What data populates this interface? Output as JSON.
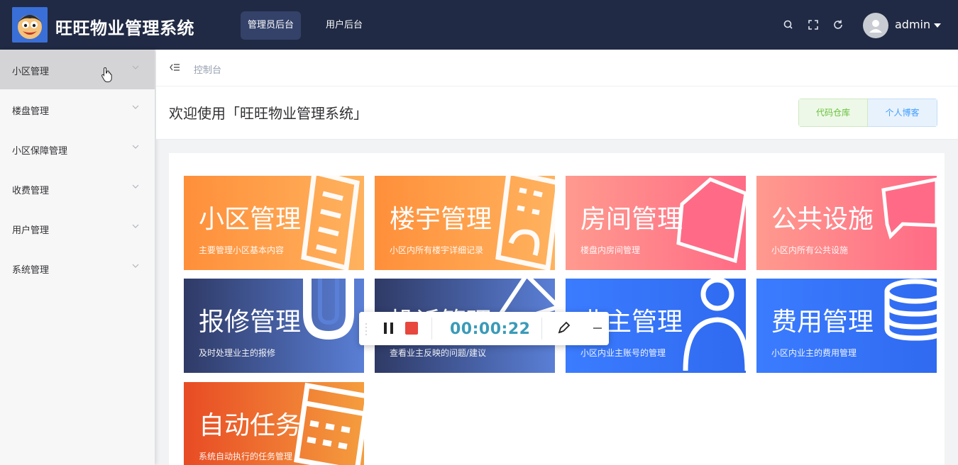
{
  "header": {
    "app_title": "旺旺物业管理系统",
    "tabs": [
      {
        "label": "管理员后台",
        "active": true
      },
      {
        "label": "用户后台",
        "active": false
      }
    ],
    "icons": [
      "search-icon",
      "fullscreen-icon",
      "refresh-icon"
    ],
    "user": {
      "name": "admin"
    },
    "background": "#202a44"
  },
  "sidebar": {
    "items": [
      {
        "label": "小区管理",
        "active": true
      },
      {
        "label": "楼盘管理",
        "active": false
      },
      {
        "label": "小区保障管理",
        "active": false
      },
      {
        "label": "收费管理",
        "active": false
      },
      {
        "label": "用户管理",
        "active": false
      },
      {
        "label": "系统管理",
        "active": false
      }
    ]
  },
  "breadcrumb": {
    "current": "控制台"
  },
  "welcome": {
    "title": "欢迎使用「旺旺物业管理系统」",
    "buttons": {
      "repo": "代码仓库",
      "blog": "个人博客"
    }
  },
  "cards": [
    {
      "title": "小区管理",
      "subtitle": "主要管理小区基本内容",
      "icon": "building-icon",
      "colors": [
        "#ff8f3a",
        "#ffb25e"
      ]
    },
    {
      "title": "楼宇管理",
      "subtitle": "小区内所有楼宇详细记录",
      "icon": "tower-icon",
      "colors": [
        "#ff8f3a",
        "#ffb25e"
      ]
    },
    {
      "title": "房间管理",
      "subtitle": "楼盘内房间管理",
      "icon": "house-icon",
      "colors": [
        "#ff9a8e",
        "#ff6b86"
      ]
    },
    {
      "title": "公共设施",
      "subtitle": "小区内所有公共设施",
      "icon": "flag-icon",
      "colors": [
        "#ff9a8e",
        "#ff6b86"
      ]
    },
    {
      "title": "报修管理",
      "subtitle": "及时处理业主的报修",
      "icon": "magnet-icon",
      "colors": [
        "#2f3a66",
        "#5a7fd6"
      ]
    },
    {
      "title": "投诉管理",
      "subtitle": "查看业主反映的问题/建议",
      "icon": "triangle-icon",
      "colors": [
        "#2f3a66",
        "#5a7fd6"
      ]
    },
    {
      "title": "业主管理",
      "subtitle": "小区内业主账号的管理",
      "icon": "person-icon",
      "colors": [
        "#3b7cff",
        "#2f6af0"
      ]
    },
    {
      "title": "费用管理",
      "subtitle": "小区内业主的费用管理",
      "icon": "coins-icon",
      "colors": [
        "#3b7cff",
        "#2f6af0"
      ]
    },
    {
      "title": "自动任务",
      "subtitle": "系统自动执行的任务管理",
      "icon": "calendar-icon",
      "colors": [
        "#e84b24",
        "#f59d3e"
      ]
    }
  ],
  "recorder": {
    "time": "00:00:22",
    "stop_color": "#e8473e",
    "time_color": "#3a9bb8"
  }
}
